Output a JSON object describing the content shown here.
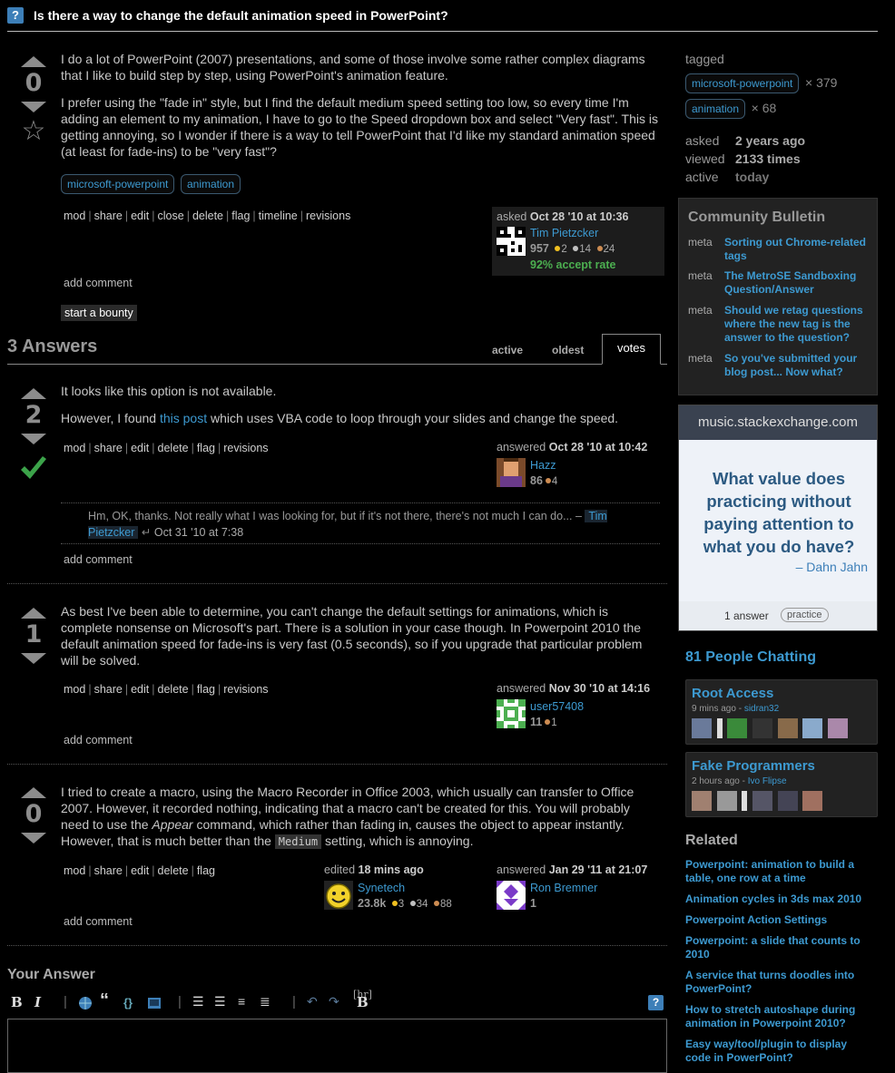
{
  "question": {
    "icon": "?",
    "title": "Is there a way to change the default animation speed in PowerPoint?",
    "votes": "0",
    "paragraphs": [
      "I do a lot of PowerPoint (2007) presentations, and some of those involve some rather complex diagrams that I like to build step by step, using PowerPoint's animation feature.",
      "I prefer using the \"fade in\" style, but I find the default medium speed setting too low, so every time I'm adding an element to my animation, I have to go to the Speed dropdown box and select \"Very fast\". This is getting annoying, so I wonder if there is a way to tell PowerPoint that I'd like my standard animation speed (at least for fade-ins) to be \"very fast\"?"
    ],
    "tags": [
      "microsoft-powerpoint",
      "animation"
    ],
    "menu": [
      "mod",
      "share",
      "edit",
      "close",
      "delete",
      "flag",
      "timeline",
      "revisions"
    ],
    "asked_label": "asked",
    "asked_date": "Oct 28 '10 at 10:36",
    "user": "Tim Pietzcker",
    "rep": "957",
    "badges": {
      "gold": "2",
      "silver": "14",
      "bronze": "24"
    },
    "accept_rate": "92% accept rate",
    "add_comment": "add comment",
    "bounty": "start a bounty"
  },
  "answers_header": {
    "count": "3 Answers",
    "tabs": [
      "active",
      "oldest",
      "votes"
    ]
  },
  "answers": [
    {
      "votes": "2",
      "accepted": true,
      "p1": "It looks like this option is not available.",
      "p2_before": "However, I found ",
      "p2_link": "this post",
      "p2_after": " which uses VBA code to loop through your slides and change the speed.",
      "menu": [
        "mod",
        "share",
        "edit",
        "delete",
        "flag",
        "revisions"
      ],
      "answered_label": "answered",
      "date": "Oct 28 '10 at 10:42",
      "user": "Hazz",
      "rep": "86",
      "bronze": "4",
      "comment": {
        "text": "Hm, OK, thanks. Not really what I was looking for, but if it's not there, there's not much I can do... –",
        "user": "Tim Pietzcker",
        "date": "Oct 31 '10 at 7:38"
      },
      "add_comment": "add comment"
    },
    {
      "votes": "1",
      "text": "As best I've been able to determine, you can't change the default settings for animations, which is complete nonsense on Microsoft's part. There is a solution in your case though. In Powerpoint 2010 the default animation speed for fade-ins is very fast (0.5 seconds), so if you upgrade that particular problem will be solved.",
      "menu": [
        "mod",
        "share",
        "edit",
        "delete",
        "flag",
        "revisions"
      ],
      "answered_label": "answered",
      "date": "Nov 30 '10 at 14:16",
      "user": "user57408",
      "rep": "11",
      "bronze": "1",
      "add_comment": "add comment"
    },
    {
      "votes": "0",
      "t1": "I tried to create a macro, using the Macro Recorder in Office 2003, which usually can transfer to Office 2007. However, it recorded nothing, indicating that a macro can't be created for this. You will probably need to use the ",
      "t_em": "Appear",
      "t2": " command, which rather than fading in, causes the object to appear instantly. However, that is much better than the ",
      "t_code": "Medium",
      "t3": " setting, which is annoying.",
      "menu": [
        "mod",
        "share",
        "edit",
        "delete",
        "flag"
      ],
      "edited_label": "edited",
      "edited_date": "18 mins ago",
      "editor": "Synetech",
      "editor_rep": "23.8k",
      "editor_badges": {
        "gold": "3",
        "silver": "34",
        "bronze": "88"
      },
      "answered_label": "answered",
      "date": "Jan 29 '11 at 21:07",
      "user": "Ron Bremner",
      "rep": "1",
      "add_comment": "add comment"
    }
  ],
  "sidebar": {
    "tagged_label": "tagged",
    "tags": [
      {
        "name": "microsoft-powerpoint",
        "count": "× 379"
      },
      {
        "name": "animation",
        "count": "× 68"
      }
    ],
    "stats": [
      {
        "label": "asked",
        "value": "2 years ago"
      },
      {
        "label": "viewed",
        "value": "2133 times"
      },
      {
        "label": "active",
        "value": "today"
      }
    ],
    "bulletin": {
      "title": "Community Bulletin",
      "items": [
        {
          "meta": "meta",
          "text": "Sorting out Chrome-related tags"
        },
        {
          "meta": "meta",
          "text": "The MetroSE Sandboxing Question/Answer"
        },
        {
          "meta": "meta",
          "text": "Should we retag questions where the new tag is the answer to the question?"
        },
        {
          "meta": "meta",
          "text": "So you've submitted your blog post... Now what?"
        }
      ]
    },
    "ad": {
      "site": "music.stackexchange.com",
      "question": "What value does practicing without paying attention to what you do have?",
      "author": "– Dahn Jahn",
      "answers": "1 answer",
      "tag": "practice"
    },
    "chat": {
      "title": "81 People Chatting",
      "rooms": [
        {
          "name": "Root Access",
          "time": "9 mins ago",
          "user": "sidran32"
        },
        {
          "name": "Fake Programmers",
          "time": "2 hours ago",
          "user": "Ivo Flipse"
        }
      ]
    },
    "related_title": "Related",
    "related": [
      "Powerpoint: animation to build a table, one row at a time",
      "Animation cycles in 3ds max 2010",
      "Powerpoint Action Settings",
      "Powerpoint: a slide that counts to 2010",
      "A service that turns doodles into PowerPoint?",
      "How to stretch autoshape during animation in Powerpoint 2010?",
      "Easy way/tool/plugin to display code in PowerPoint?"
    ]
  },
  "your_answer": {
    "title": "Your Answer",
    "toolbar": {
      "bold": "B",
      "italic": "I",
      "quote": "“",
      "code": "{}",
      "hr_overlay": "B",
      "hr_text": "[hr]",
      "help": "?"
    }
  },
  "colors": {
    "link": "#3d9ad1",
    "accepted": "#3ca34a",
    "background": "#000000"
  }
}
